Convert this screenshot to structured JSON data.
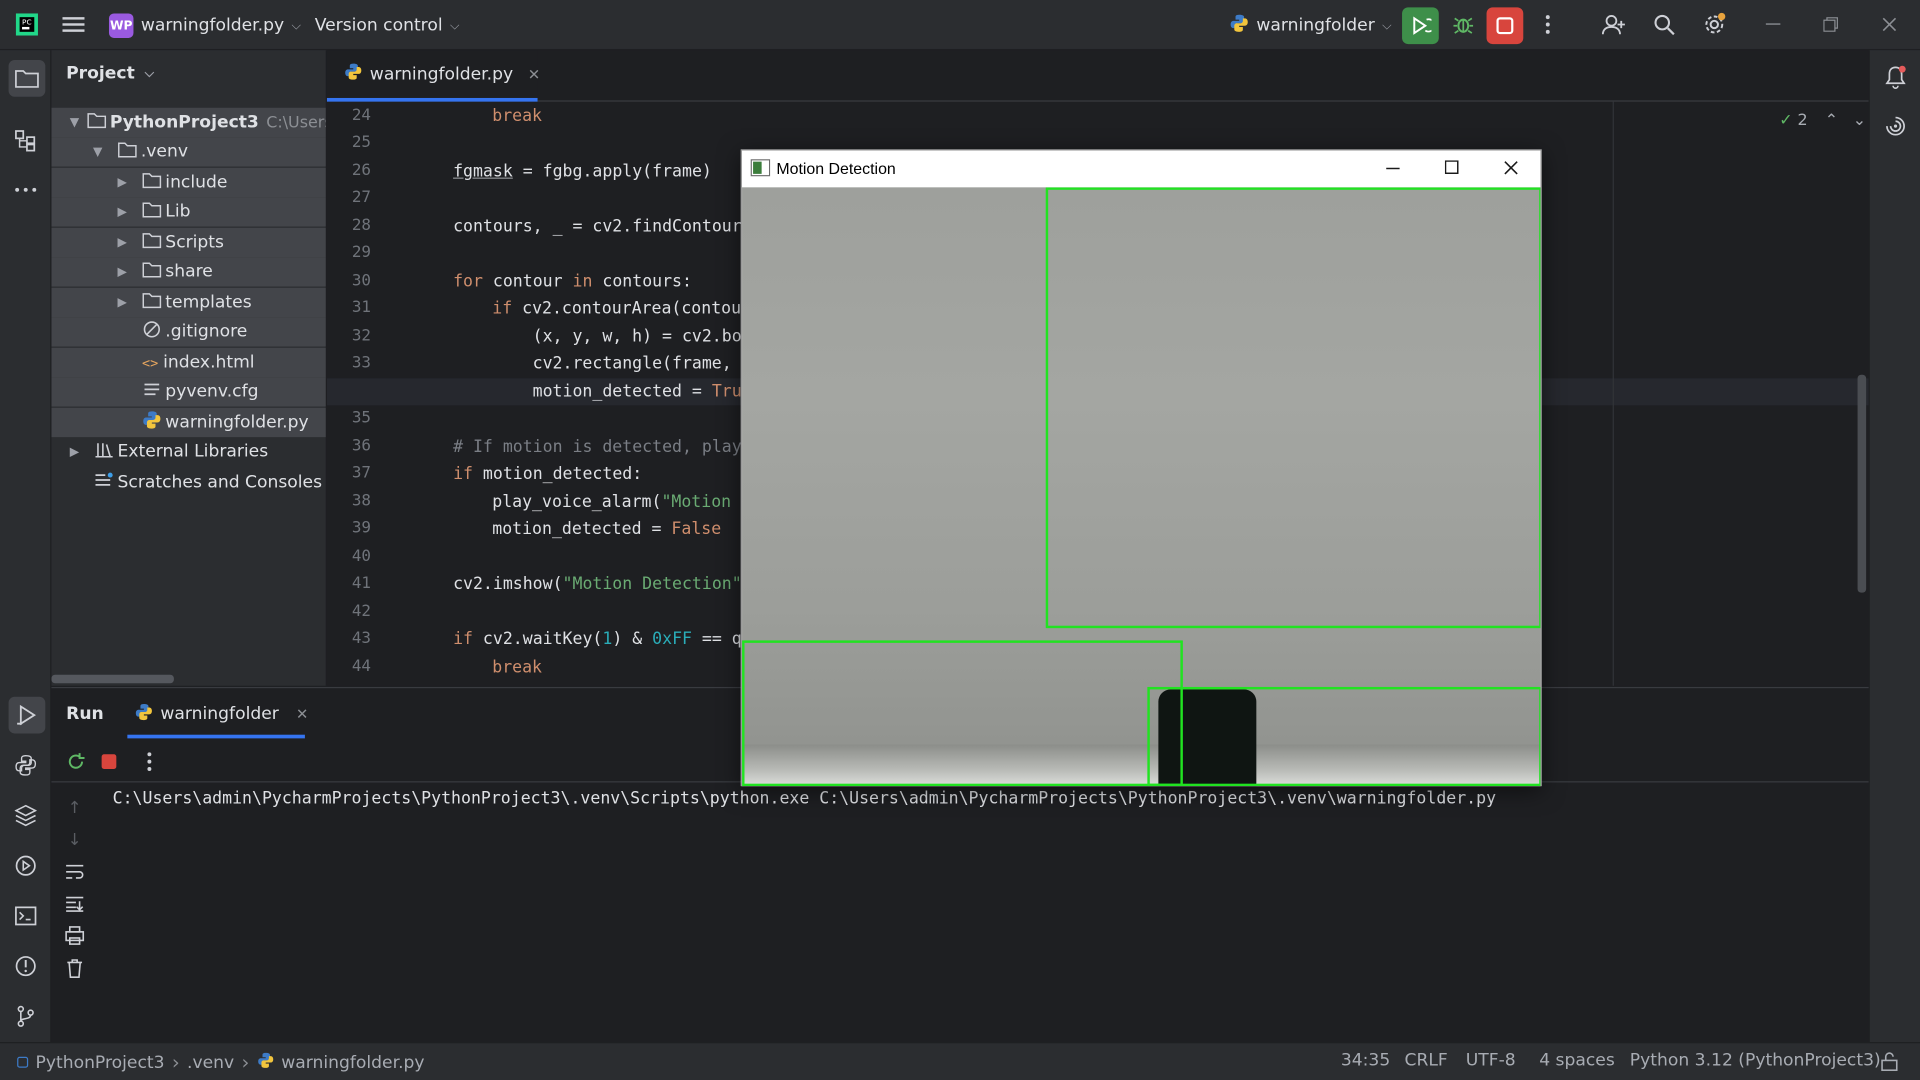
{
  "titlebar": {
    "project_badge": "WP",
    "project_name": "warningfolder.py",
    "vcs": "Version control",
    "run_config": "warningfolder"
  },
  "project_panel": {
    "title": "Project",
    "tree": [
      {
        "label": "PythonProject3",
        "hint": "C:\\Users\\",
        "type": "project"
      },
      {
        "label": ".venv",
        "type": "folder"
      },
      {
        "label": "include",
        "type": "folder"
      },
      {
        "label": "Lib",
        "type": "folder"
      },
      {
        "label": "Scripts",
        "type": "folder"
      },
      {
        "label": "share",
        "type": "folder"
      },
      {
        "label": "templates",
        "type": "folder"
      },
      {
        "label": ".gitignore",
        "type": "ignore"
      },
      {
        "label": "index.html",
        "type": "html"
      },
      {
        "label": "pyvenv.cfg",
        "type": "cfg"
      },
      {
        "label": "warningfolder.py",
        "type": "python"
      },
      {
        "label": "External Libraries",
        "type": "library"
      },
      {
        "label": "Scratches and Consoles",
        "type": "scratch"
      }
    ]
  },
  "editor": {
    "tab_label": "warningfolder.py",
    "inspection_count": "2",
    "current_line": "34",
    "lines": [
      {
        "n": "24",
        "text": ""
      },
      {
        "n": "25",
        "text": ""
      },
      {
        "n": "26",
        "text": ""
      },
      {
        "n": "27",
        "text": ""
      },
      {
        "n": "28",
        "text": ""
      },
      {
        "n": "29",
        "text": ""
      },
      {
        "n": "30",
        "text": ""
      },
      {
        "n": "31",
        "text": ""
      },
      {
        "n": "32",
        "text": ""
      },
      {
        "n": "33",
        "text": ""
      },
      {
        "n": "34",
        "text": ""
      },
      {
        "n": "35",
        "text": ""
      },
      {
        "n": "36",
        "text": ""
      },
      {
        "n": "37",
        "text": ""
      },
      {
        "n": "38",
        "text": ""
      },
      {
        "n": "39",
        "text": ""
      },
      {
        "n": "40",
        "text": ""
      },
      {
        "n": "41",
        "text": ""
      },
      {
        "n": "42",
        "text": ""
      },
      {
        "n": "43",
        "text": ""
      },
      {
        "n": "44",
        "text": ""
      }
    ],
    "code": {
      "l24": "break",
      "l26a": "fgmask",
      "l26b": " = fgbg.apply(frame)",
      "l28": "contours, _ = cv2.findContour",
      "l30a": "for",
      "l30b": " contour ",
      "l30c": "in",
      "l30d": " contours:",
      "l31a": "if",
      "l31b": " cv2.contourArea(contou",
      "l32": "(x, y, w, h) = cv2.bo",
      "l33": "cv2.rectangle(frame,",
      "l34a": "motion_detected = ",
      "l34b": "Tru",
      "l36": "# If motion is detected, play",
      "l37a": "if",
      "l37b": " motion_detected:",
      "l38a": "play_voice_alarm(",
      "l38b": "\"Motion",
      "l39a": "motion_detected = ",
      "l39b": "False",
      "l41a": "cv2.imshow(",
      "l41b": "\"Motion Detection\"",
      "l43a": "if",
      "l43b": " cv2.waitKey(",
      "l43c": "1",
      "l43d": ") & ",
      "l43e": "0xFF",
      "l43f": " == q",
      "l44": "break"
    }
  },
  "run_panel": {
    "title": "Run",
    "tab_label": "warningfolder",
    "console_line": "C:\\Users\\admin\\PycharmProjects\\PythonProject3\\.venv\\Scripts\\python.exe C:\\Users\\admin\\PycharmProjects\\PythonProject3\\.venv\\warningfolder.py"
  },
  "status_bar": {
    "crumbs": [
      "PythonProject3",
      ".venv",
      "warningfolder.py"
    ],
    "position": "34:35",
    "line_sep": "CRLF",
    "encoding": "UTF-8",
    "indent": "4 spaces",
    "interpreter": "Python 3.12 (PythonProject3)"
  },
  "motion_window": {
    "title": "Motion Detection",
    "box_color": "#21e321"
  },
  "colors": {
    "ide_bg": "#1e1f22",
    "panel_bg": "#2b2d30",
    "selection": "#43454a",
    "run_green": "#3e8f4a",
    "stop_red": "#d8453d"
  }
}
